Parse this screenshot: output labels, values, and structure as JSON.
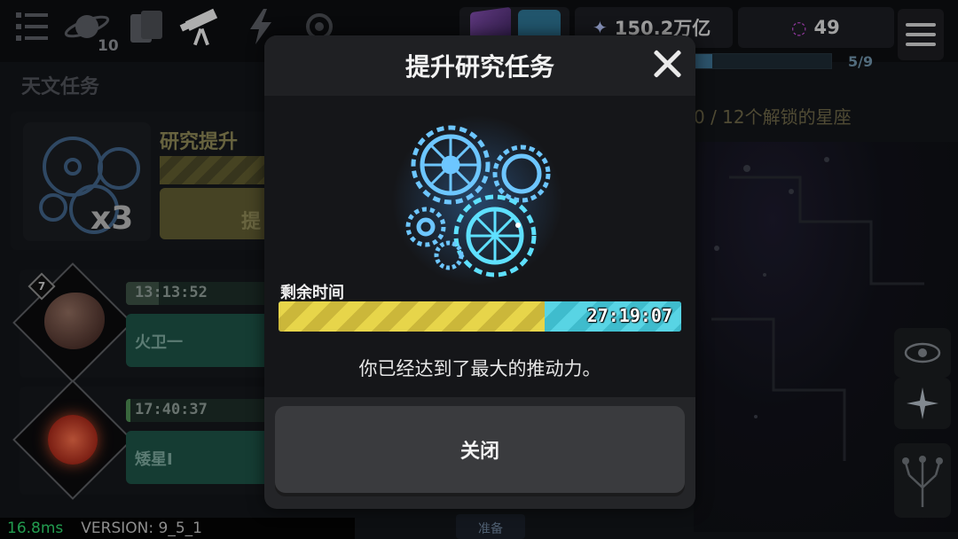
{
  "topbar": {
    "planet_count": "10",
    "stardust": "150.2万亿",
    "dark_matter": "49",
    "constellation_progress": "5/9",
    "constellation_progress_fraction": 0.14
  },
  "left_panel": {
    "title": "天文任务",
    "upgrade_title": "研究提升",
    "upgrade_multiplier": "x3",
    "upgrade_button_partial": "提",
    "missions": [
      {
        "level": "7",
        "timer": "13:13:52",
        "name": "火卫一",
        "progress": 0.22
      },
      {
        "timer": "17:40:37",
        "name": "矮星Ⅰ",
        "progress": 0.03
      }
    ]
  },
  "right_panel": {
    "constellations_text": "0 / 12个解锁的星座"
  },
  "status": {
    "fps": "16.8ms",
    "version": "VERSION: 9_5_1",
    "prepare_label": "准备"
  },
  "modal": {
    "title": "提升研究任务",
    "remaining_label": "剩余时间",
    "remaining_time": "27:19:07",
    "elapsed_fraction": 0.66,
    "message": "你已经达到了最大的推动力。",
    "close_button": "关闭"
  },
  "colors": {
    "accent_yellow": "#e7d54a",
    "accent_cyan": "#58d4e4",
    "mission_green": "#1d5145"
  }
}
